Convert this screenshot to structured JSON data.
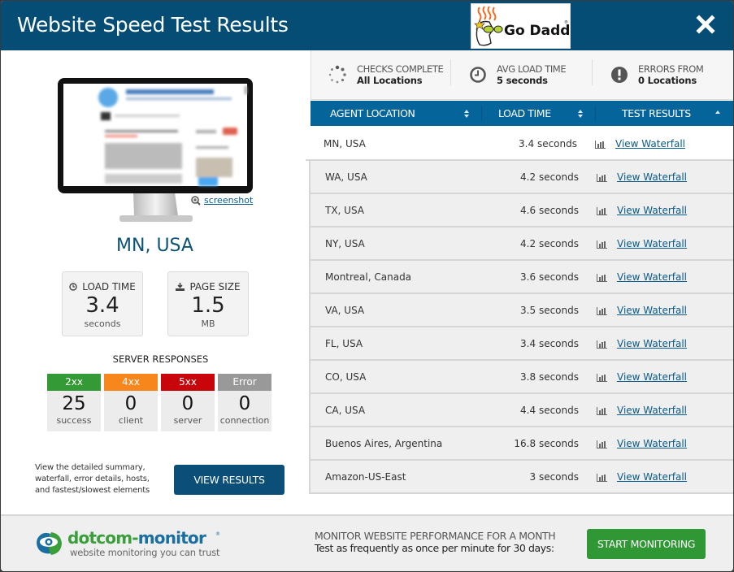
{
  "header": {
    "title": "Website Speed Test Results",
    "brand_logo_text": "Go Daddy",
    "close_icon": "close-icon"
  },
  "left": {
    "screenshot_link": "screenshot",
    "location": "MN, USA",
    "load_time": {
      "label": "LOAD TIME",
      "value": "3.4",
      "unit": "seconds",
      "icon": "clock-icon"
    },
    "page_size": {
      "label": "PAGE SIZE",
      "value": "1.5",
      "unit": "MB",
      "icon": "download-icon"
    },
    "server_responses": {
      "title": "SERVER RESPONSES",
      "items": [
        {
          "code": "2xx",
          "count": "25",
          "desc": "success",
          "color": "#349a35"
        },
        {
          "code": "4xx",
          "count": "0",
          "desc": "client",
          "color": "#f7871d"
        },
        {
          "code": "5xx",
          "count": "0",
          "desc": "server",
          "color": "#c9050c"
        },
        {
          "code": "Error",
          "count": "0",
          "desc": "connection",
          "color": "#999999"
        }
      ]
    },
    "view_results_text": "View the detailed summary, waterfall, error details, hosts, and fastest/slowest elements",
    "view_results_button": "VIEW RESULTS"
  },
  "summary": {
    "checks": {
      "label": "CHECKS COMPLETE",
      "value": "All Locations"
    },
    "avg": {
      "label": "AVG LOAD TIME",
      "value": "5 seconds"
    },
    "errors": {
      "label": "ERRORS FROM",
      "value": "0 Locations"
    }
  },
  "table": {
    "columns": [
      "AGENT LOCATION",
      "LOAD TIME",
      "TEST RESULTS"
    ],
    "link_label": "View Waterfall",
    "rows": [
      {
        "location": "MN, USA",
        "load_time": "3.4 seconds"
      },
      {
        "location": "WA, USA",
        "load_time": "4.2 seconds"
      },
      {
        "location": "TX, USA",
        "load_time": "4.6 seconds"
      },
      {
        "location": "NY, USA",
        "load_time": "4.2 seconds"
      },
      {
        "location": "Montreal, Canada",
        "load_time": "3.6 seconds"
      },
      {
        "location": "VA, USA",
        "load_time": "3.5 seconds"
      },
      {
        "location": "FL, USA",
        "load_time": "3.4 seconds"
      },
      {
        "location": "CO, USA",
        "load_time": "3.8 seconds"
      },
      {
        "location": "CA, USA",
        "load_time": "4.4 seconds"
      },
      {
        "location": "Buenos Aires, Argentina",
        "load_time": "16.8 seconds"
      },
      {
        "location": "Amazon-US-East",
        "load_time": "3 seconds"
      }
    ]
  },
  "footer": {
    "logo_name": "dotcom-monitor",
    "logo_tagline": "website monitoring you can trust",
    "promo_title": "MONITOR WEBSITE PERFORMANCE FOR A MONTH",
    "promo_text": "Test as frequently as once per minute for 30 days:",
    "start_button": "START MONITORING"
  },
  "colors": {
    "header_bg": "#054d75",
    "table_header_bg": "#05659b",
    "accent_green": "#2f9734",
    "link": "#0a5a8a"
  }
}
